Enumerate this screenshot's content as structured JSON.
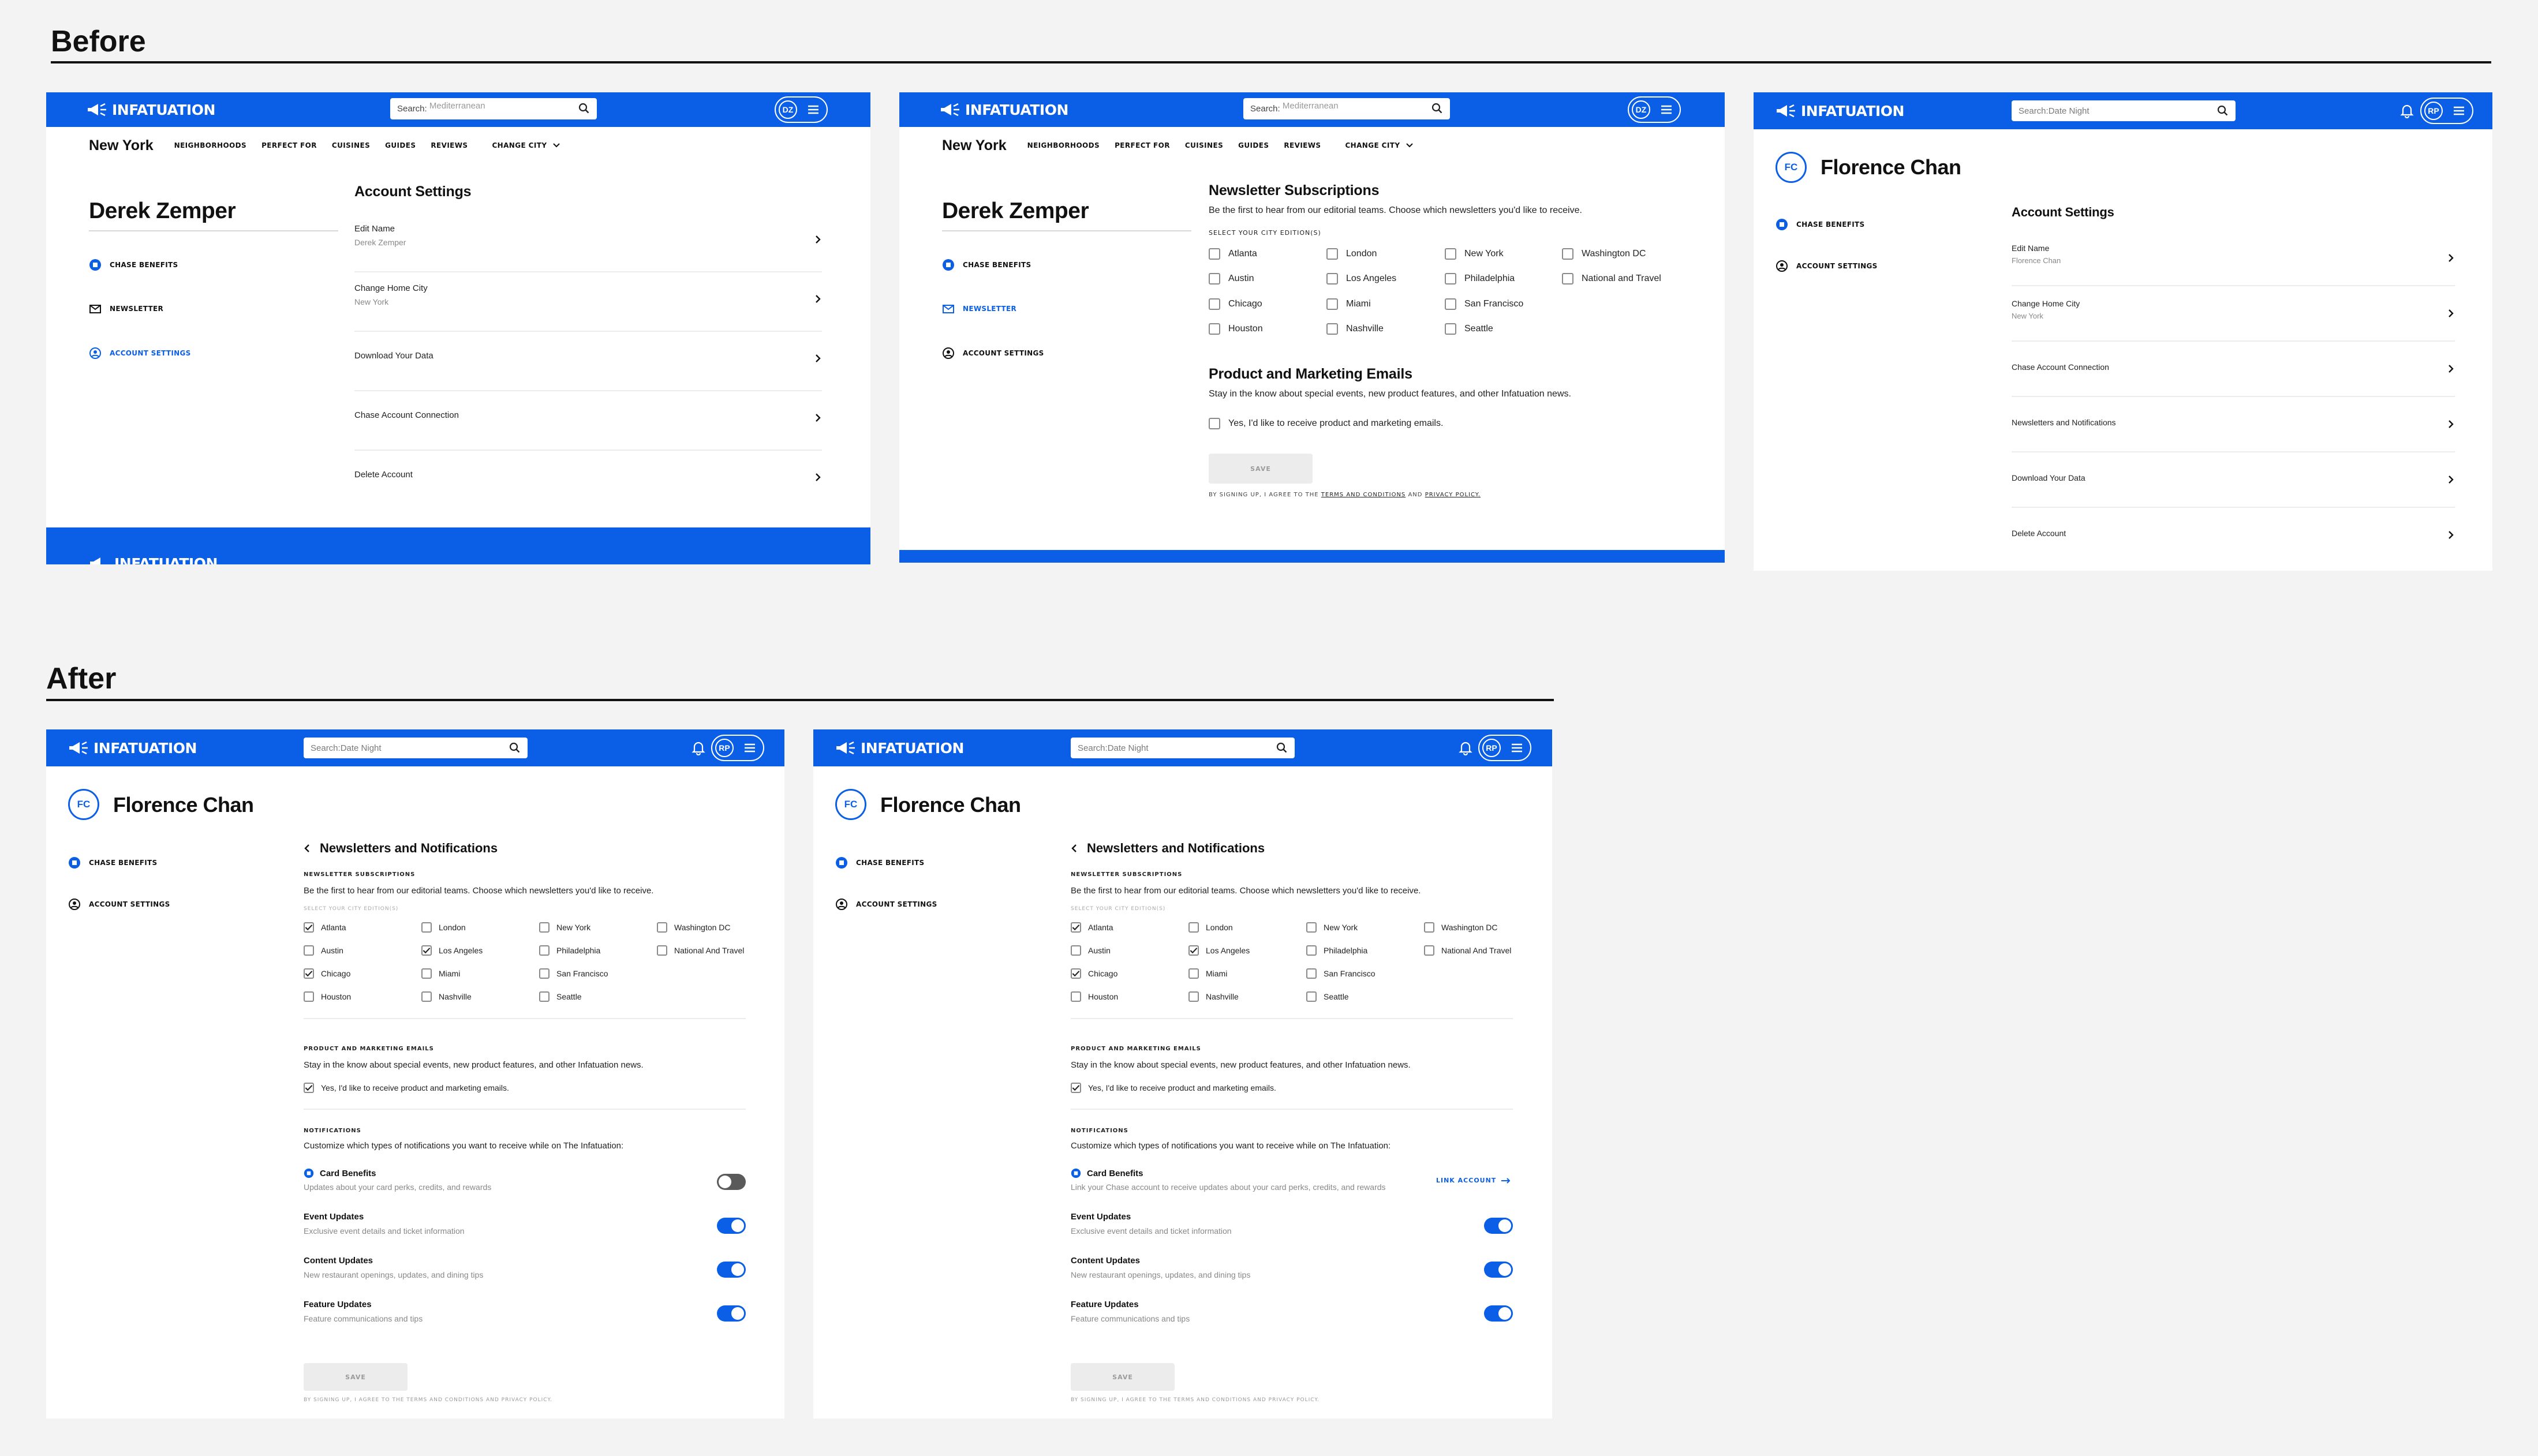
{
  "sections": {
    "before": "Before",
    "after": "After"
  },
  "brand": {
    "name": "INFATUATION",
    "blue": "#0a5fe6"
  },
  "before_screens": [
    {
      "search_placeholder": "Search:",
      "search_value": "Mediterranean",
      "avatar": "DZ",
      "city": "New York",
      "nav": [
        "NEIGHBORHOODS",
        "PERFECT FOR",
        "CUISINES",
        "GUIDES",
        "REVIEWS",
        "CHANGE CITY"
      ],
      "user_name": "Derek Zemper",
      "sidebar": [
        "CHASE BENEFITS",
        "NEWSLETTER",
        "ACCOUNT SETTINGS"
      ],
      "heading": "Account Settings",
      "rows": [
        {
          "title": "Edit Name",
          "sub": "Derek Zemper"
        },
        {
          "title": "Change Home City",
          "sub": "New York"
        },
        {
          "title": "Download Your Data",
          "sub": ""
        },
        {
          "title": "Chase Account Connection",
          "sub": ""
        },
        {
          "title": "Delete Account",
          "sub": ""
        }
      ],
      "footer_logo": "INFATUATION"
    },
    {
      "search_placeholder": "Search:",
      "search_value": "Mediterranean",
      "avatar": "DZ",
      "city": "New York",
      "nav": [
        "NEIGHBORHOODS",
        "PERFECT FOR",
        "CUISINES",
        "GUIDES",
        "REVIEWS",
        "CHANGE CITY"
      ],
      "user_name": "Derek Zemper",
      "sidebar": [
        "CHASE BENEFITS",
        "NEWSLETTER",
        "ACCOUNT SETTINGS"
      ],
      "heading": "Newsletter Subscriptions",
      "desc": "Be the first to hear from our editorial teams. Choose which newsletters you'd like to receive.",
      "city_label": "SELECT YOUR CITY EDITION(S)",
      "cities": [
        "Atlanta",
        "London",
        "New York",
        "Washington DC",
        "Austin",
        "Los Angeles",
        "Philadelphia",
        "National and Travel",
        "Chicago",
        "Miami",
        "San Francisco",
        "Houston",
        "Nashville",
        "Seattle"
      ],
      "marketing_heading": "Product and Marketing Emails",
      "marketing_desc": "Stay in the know about special events, new product features, and other Infatuation news.",
      "marketing_opt": "Yes, I'd like to receive product and marketing emails.",
      "save": "SAVE",
      "terms_pre": "BY SIGNING UP, I AGREE TO THE",
      "terms_link1": "TERMS AND CONDITIONS",
      "terms_and": "AND",
      "terms_link2": "PRIVACY POLICY."
    },
    {
      "search_placeholder": "Search:Date Night",
      "avatar": "RP",
      "initials": "FC",
      "user_name": "Florence Chan",
      "sidebar": [
        "CHASE BENEFITS",
        "ACCOUNT SETTINGS"
      ],
      "heading": "Account Settings",
      "rows": [
        {
          "title": "Edit Name",
          "sub": "Florence Chan"
        },
        {
          "title": "Change Home City",
          "sub": "New York"
        },
        {
          "title": "Chase Account Connection",
          "sub": ""
        },
        {
          "title": "Newsletters and Notifications",
          "sub": ""
        },
        {
          "title": "Download Your Data",
          "sub": ""
        },
        {
          "title": "Delete Account",
          "sub": ""
        }
      ]
    }
  ],
  "after_common": {
    "search_placeholder": "Search:Date Night",
    "avatar": "RP",
    "initials": "FC",
    "user_name": "Florence Chan",
    "sidebar": [
      "CHASE BENEFITS",
      "ACCOUNT SETTINGS"
    ],
    "back_title": "Newsletters and Notifications",
    "newsletter_heading": "NEWSLETTER SUBSCRIPTIONS",
    "newsletter_desc": "Be the first to hear from our editorial teams. Choose which newsletters you'd like to receive.",
    "city_label": "SELECT YOUR CITY EDITION(S)",
    "cities": [
      {
        "name": "Atlanta",
        "checked": true
      },
      {
        "name": "London",
        "checked": false
      },
      {
        "name": "New York",
        "checked": false
      },
      {
        "name": "Washington DC",
        "checked": false
      },
      {
        "name": "Austin",
        "checked": false
      },
      {
        "name": "Los Angeles",
        "checked": true
      },
      {
        "name": "Philadelphia",
        "checked": false
      },
      {
        "name": "National And Travel",
        "checked": false
      },
      {
        "name": "Chicago",
        "checked": true
      },
      {
        "name": "Miami",
        "checked": false
      },
      {
        "name": "San Francisco",
        "checked": false
      },
      {
        "name": "Houston",
        "checked": false
      },
      {
        "name": "Nashville",
        "checked": false
      },
      {
        "name": "Seattle",
        "checked": false
      }
    ],
    "marketing_heading": "PRODUCT AND MARKETING EMAILS",
    "marketing_desc": "Stay in the know about special events, new product features, and other Infatuation news.",
    "marketing_opt": "Yes, I'd like to receive product and marketing emails.",
    "notif_heading": "NOTIFICATIONS",
    "notif_desc": "Customize which types of notifications you want to receive while on The Infatuation:",
    "save": "SAVE",
    "terms": "BY SIGNING UP, I AGREE TO THE TERMS AND CONDITIONS AND PRIVACY POLICY."
  },
  "after_screens": [
    {
      "notifications": [
        {
          "title": "Card Benefits",
          "sub": "Updates about your card perks, credits, and rewards",
          "on": false
        },
        {
          "title": "Event Updates",
          "sub": "Exclusive event details and ticket information",
          "on": true
        },
        {
          "title": "Content Updates",
          "sub": "New restaurant openings, updates, and dining tips",
          "on": true
        },
        {
          "title": "Feature Updates",
          "sub": "Feature communications and tips",
          "on": true
        }
      ]
    },
    {
      "notifications": [
        {
          "title": "Card Benefits",
          "sub": "Link your Chase account to receive updates about your card perks, credits, and rewards",
          "link": "LINK ACCOUNT"
        },
        {
          "title": "Event Updates",
          "sub": "Exclusive event details and ticket information",
          "on": true
        },
        {
          "title": "Content Updates",
          "sub": "New restaurant openings, updates, and dining tips",
          "on": true
        },
        {
          "title": "Feature Updates",
          "sub": "Feature communications and tips",
          "on": true
        }
      ]
    }
  ]
}
